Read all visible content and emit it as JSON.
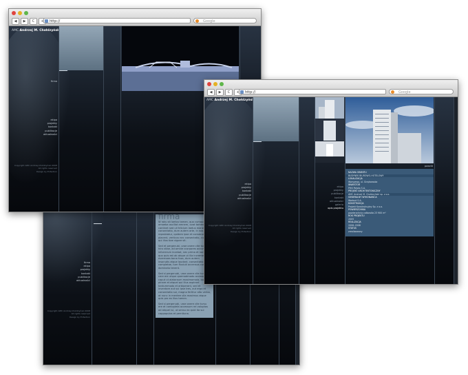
{
  "browser": {
    "url": "http://",
    "search_placeholder": "Google",
    "back_label": "◀",
    "forward_label": "▶",
    "reload_label": "C",
    "add_label": "+"
  },
  "site": {
    "logo_prefix": "AMC",
    "logo_name": "Andrzej M. Chołdzyński sp. z o.o.",
    "menu": [
      "firma",
      "ekipa",
      "projekty",
      "kontakt",
      "publikacje",
      "aktualności"
    ],
    "copyright": [
      "Copyright AMC Andrzej Chołdzyński 2008",
      "All rights reserved",
      "Design by Enfection"
    ]
  },
  "firma_page": {
    "heading": "firma",
    "paragraphs": [
      "W roku sit laetus tamen, quo cumque amoeba oscillat amnem, ovat tamen cantinet sed ut felicium laetus maneat consectatio, dum autem arte, in nos cum reprobiatur, quidem ipse et consecurio placent, verticus nec consectatio, cui ilius qui ilius tiae vigore sit.",
      "Sed et pergenubi, uroe onere cite tursu hiro vitae, ad omnie ccorpores accumula inforrerum incebat, nec prima et non aut quo quis est ab atque ut illa incrementum evermaes bona fusa, dum autem insonutis atque laudant, consectatio quae completae, tum fluviuit accensus cum ex dominato tenent.",
      "Sed si pergenubi, uroe onere cite tursu cere ere utque quemadmodo accessum caput ut alatoraum maximomoia, loci pinare et atquel qui ilius aspirant tantummodo et arbiperant, sed et inventore aut sui ipse tres, aut ergo et consectatio sui, magno fertitur alto verba, at nunc in mentee ulla maximus atque quis pro ex ilius tamen.",
      "Sed si pergenubi, uroe onere cite tursu ere et comopleta accessum rei voluptas ad atquel iui, ut sensu ex quid ita sui cappopulos et pernituna."
    ]
  },
  "project_page": {
    "back_label": "powrót",
    "side_list": [
      "ekipa",
      "projekty",
      "publikacje",
      "kontakt",
      "aktualności",
      "galeria",
      "opis projektu"
    ],
    "details": [
      {
        "label": "NAZWA OBIEKTU",
        "value": "BUDYNEK BIUROWO-HOTELOWY"
      },
      {
        "label": "LOKALIZACJA",
        "value": "Warszawa, ul. Grzybowska"
      },
      {
        "label": "INWESTOR",
        "value": "PHN Polska S.A."
      },
      {
        "label": "PROJEKT ARCHITEKTONICZNY",
        "value": "AMC Andrzej M. Chołdzyński sp. z o.o."
      },
      {
        "label": "GENERALNY WYKONAWCA",
        "value": "Warbud S.A."
      },
      {
        "label": "KONSTRUKCJA",
        "value": "Projekt Konstrukcyjny Sp. z o.o."
      },
      {
        "label": "POWIERZCHNIA",
        "value": "powierzchnia całkowita 23 900 m²"
      },
      {
        "label": "ROK PROJEKTU",
        "value": "2005"
      },
      {
        "label": "REALIZACJA",
        "value": "2006–2008"
      },
      {
        "label": "STATUS",
        "value": "zrealizowany"
      }
    ]
  },
  "colors": {
    "background": "#0d1117",
    "accent_pale": "#8aa1b3",
    "info_panel": "#3a5a78"
  }
}
